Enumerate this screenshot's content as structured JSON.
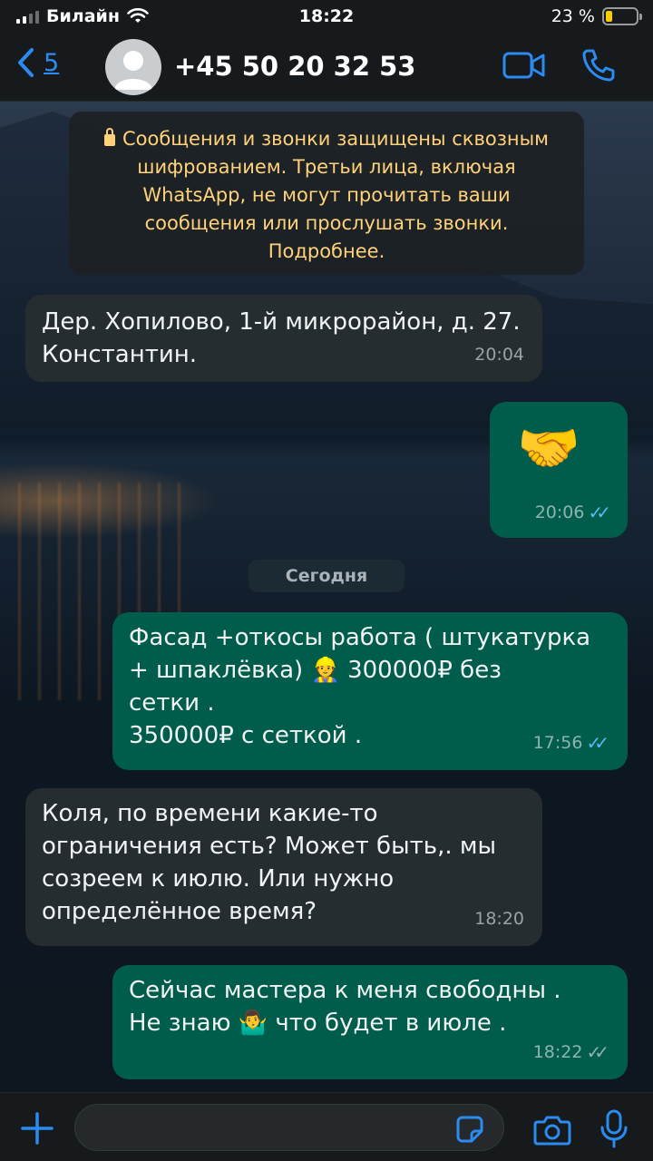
{
  "status_bar": {
    "carrier": "Билайн",
    "time": "18:22",
    "battery_text": "23 %",
    "battery_level": 0.23,
    "battery_color": "#f7cd00"
  },
  "header": {
    "back_count": "5",
    "contact": "+45 50 20 32 53",
    "accent": "#2b8bf0"
  },
  "encryption_notice": "Сообщения и звонки защищены сквозным шифрованием. Третьи лица, включая WhatsApp, не могут прочитать ваши сообщения или прослушать звонки. Подробнее.",
  "date_divider": "Сегодня",
  "messages": [
    {
      "direction": "in",
      "text": "Дер. Хопилово, 1-й микрорайон, д. 27. Константин.",
      "time": "20:04"
    },
    {
      "direction": "out",
      "text": "🤝",
      "time": "20:06",
      "status": "read"
    },
    {
      "direction": "out",
      "lines": [
        "Фасад +откосы работа ( штукатурка",
        "+ шпаклёвка) 👷 300000₽ без",
        "сетки .",
        "350000₽ с сеткой ."
      ],
      "time": "17:56",
      "status": "read"
    },
    {
      "direction": "in",
      "lines": [
        "Коля, по времени какие-то",
        "ограничения есть?  Может быть,. мы",
        "созреем к июлю. Или нужно",
        "определённое время?"
      ],
      "time": "18:20"
    },
    {
      "direction": "out",
      "lines": [
        "Сейчас мастера к меня свободны .",
        "Не знаю 🤷‍♂️ что будет в июле ."
      ],
      "time": "18:22",
      "status": "delivered"
    }
  ],
  "composer": {
    "placeholder": ""
  }
}
